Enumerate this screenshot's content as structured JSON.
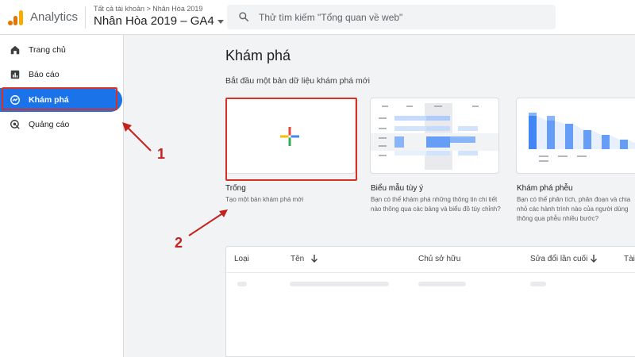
{
  "header": {
    "app_name": "Analytics",
    "breadcrumb": "Tất cả tài khoản > Nhân Hòa 2019",
    "account_name": "Nhân Hòa 2019 – GA4",
    "search_placeholder": "Thử tìm kiếm \"Tổng quan về web\""
  },
  "sidebar": {
    "items": [
      {
        "label": "Trang chủ",
        "icon": "home-icon"
      },
      {
        "label": "Báo cáo",
        "icon": "reports-icon"
      },
      {
        "label": "Khám phá",
        "icon": "explore-icon",
        "active": true
      },
      {
        "label": "Quảng cáo",
        "icon": "advertising-icon"
      }
    ]
  },
  "main": {
    "title": "Khám phá",
    "subtitle": "Bắt đầu một bản dữ liệu khám phá mới",
    "templates": [
      {
        "title": "Trống",
        "description": "Tạo một bản khám phá mới"
      },
      {
        "title": "Biểu mẫu tùy ý",
        "description": "Bạn có thể khám phá những thông tin chi tiết nào thông qua các bảng và biểu đồ tùy chỉnh?"
      },
      {
        "title": "Khám phá phễu",
        "description": "Bạn có thể phân tích, phân đoạn và chia nhỏ các hành trình nào của người dùng thông qua phễu nhiều bước?"
      }
    ],
    "table": {
      "columns": [
        "Loại",
        "Tên",
        "Chủ sở hữu",
        "Sửa đổi lần cuối",
        "Tài"
      ]
    }
  },
  "annotations": [
    "1",
    "2"
  ],
  "colors": {
    "accent": "#1a73e8",
    "highlight": "#d93025",
    "chart_bar": "#8ab4f8"
  }
}
